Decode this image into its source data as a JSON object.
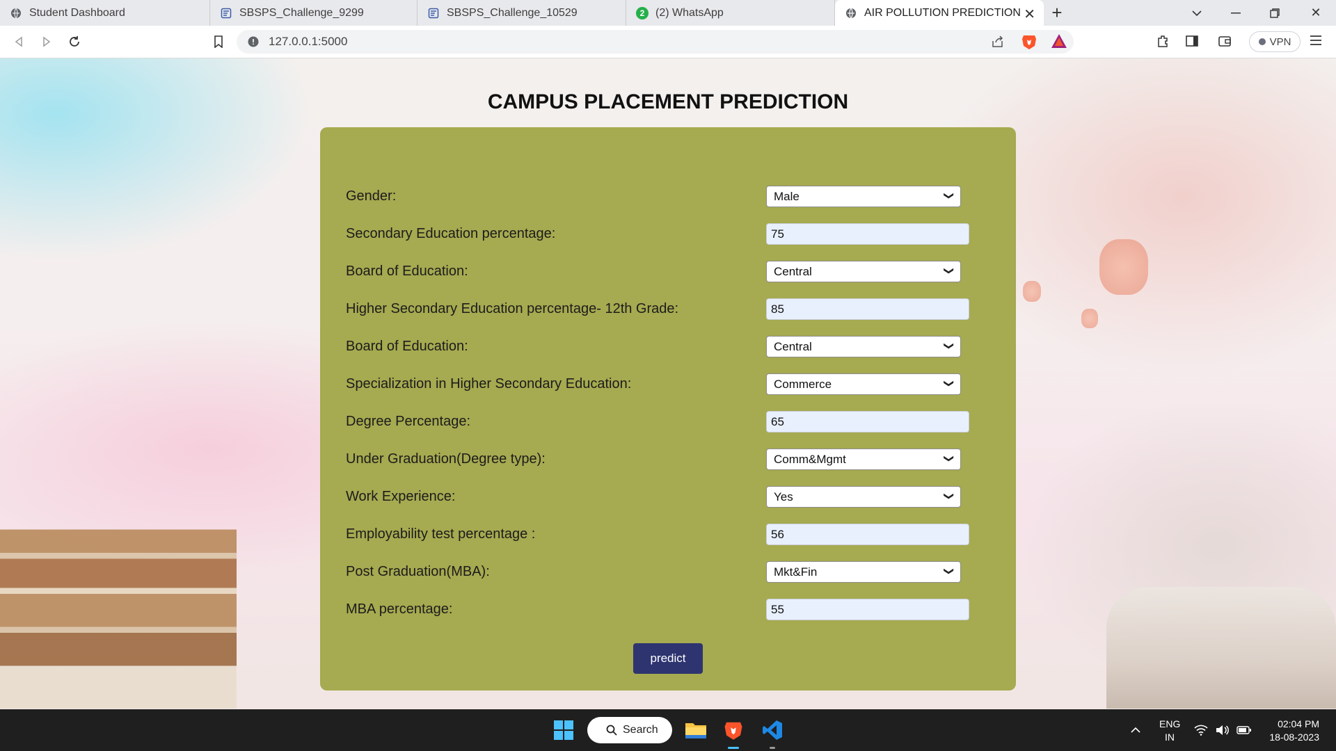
{
  "browser": {
    "tabs": [
      {
        "label": "Student Dashboard",
        "active": false
      },
      {
        "label": "SBSPS_Challenge_9299",
        "active": false
      },
      {
        "label": "SBSPS_Challenge_10529",
        "active": false
      },
      {
        "label": "(2) WhatsApp",
        "badge": "2",
        "active": false
      },
      {
        "label": "AIR POLLUTION PREDICTION",
        "active": true
      }
    ],
    "url": "127.0.0.1:5000",
    "vpn_label": "VPN"
  },
  "page": {
    "title": "CAMPUS PLACEMENT PREDICTION",
    "fields": [
      {
        "label": "Gender:",
        "type": "select",
        "value": "Male"
      },
      {
        "label": "Secondary Education percentage:",
        "type": "input",
        "value": "75"
      },
      {
        "label": "Board of Education:",
        "type": "select",
        "value": "Central"
      },
      {
        "label": "Higher Secondary Education percentage- 12th Grade:",
        "type": "input",
        "value": "85"
      },
      {
        "label": "Board of Education:",
        "type": "select",
        "value": "Central"
      },
      {
        "label": "Specialization in Higher Secondary Education:",
        "type": "select",
        "value": "Commerce"
      },
      {
        "label": "Degree Percentage:",
        "type": "input",
        "value": "65"
      },
      {
        "label": "Under Graduation(Degree type):",
        "type": "select",
        "value": "Comm&Mgmt"
      },
      {
        "label": "Work Experience:",
        "type": "select",
        "value": "Yes"
      },
      {
        "label": "Employability test percentage :",
        "type": "input",
        "value": "56"
      },
      {
        "label": "Post Graduation(MBA):",
        "type": "select",
        "value": "Mkt&Fin"
      },
      {
        "label": "MBA percentage:",
        "type": "input",
        "value": "55"
      }
    ],
    "submit_label": "predict",
    "card_color": "#a6aa50",
    "button_color": "#2e3470"
  },
  "taskbar": {
    "search_label": "Search",
    "language": "ENG",
    "region": "IN",
    "time": "02:04 PM",
    "date": "18-08-2023"
  }
}
